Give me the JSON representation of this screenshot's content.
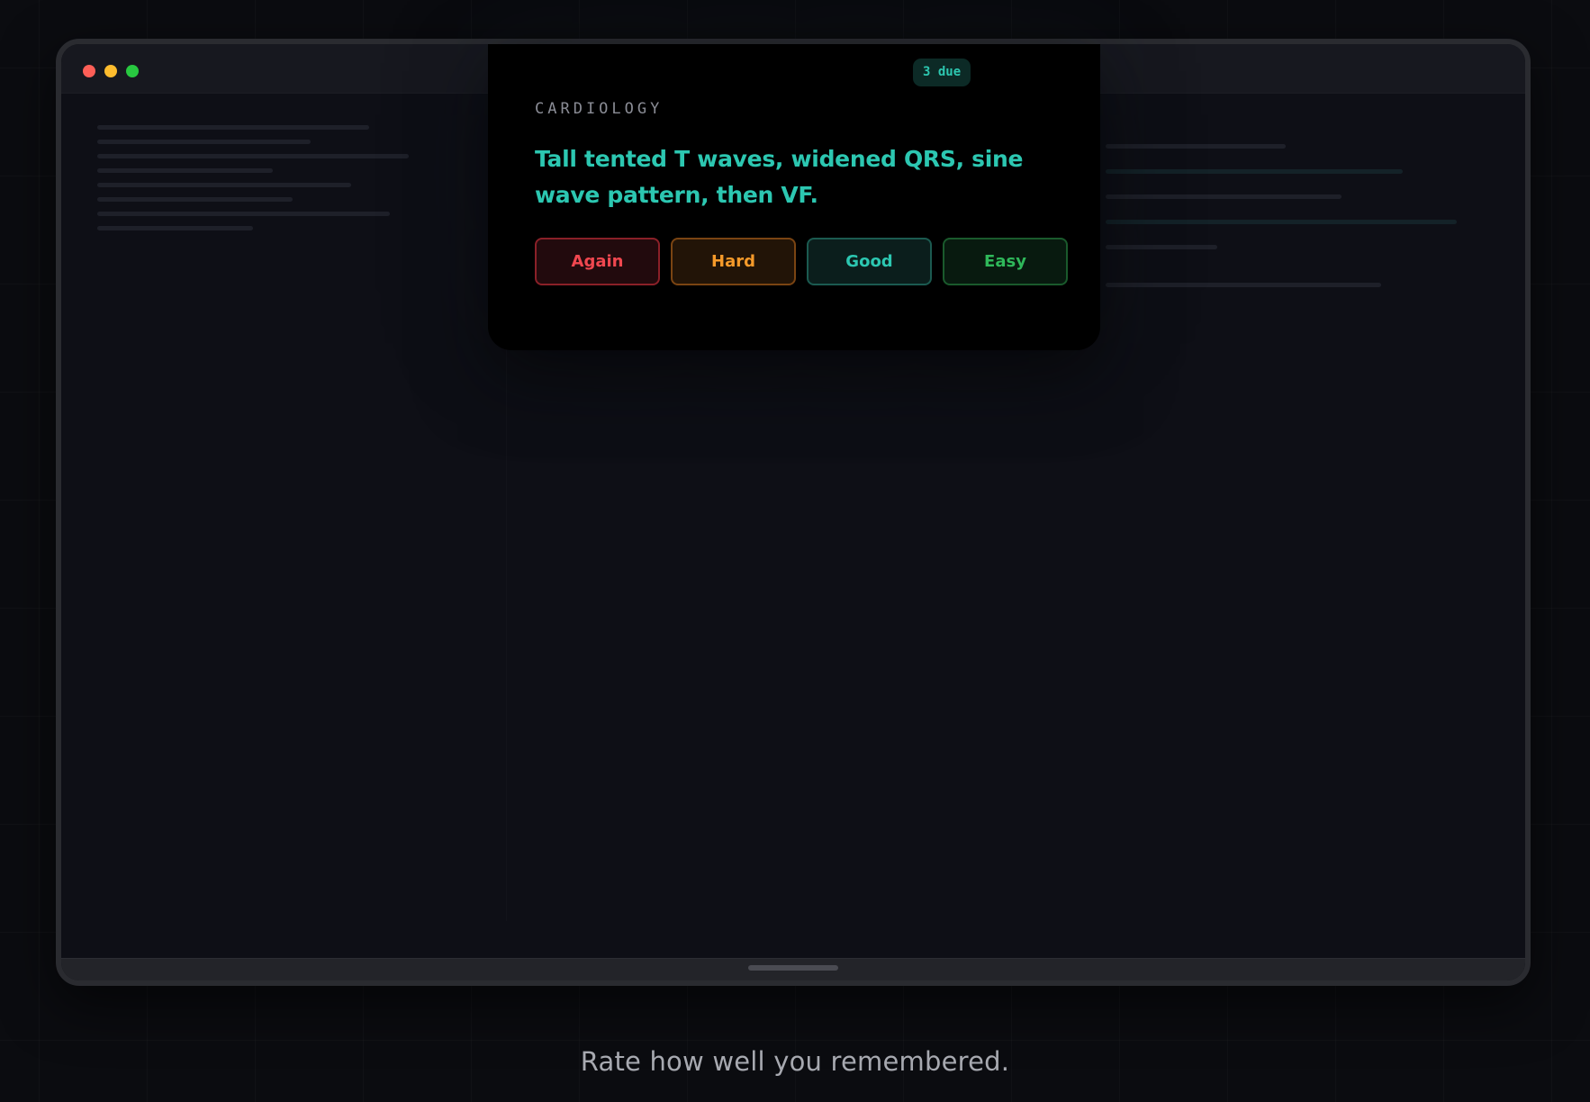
{
  "card": {
    "due_badge": "3 due",
    "category": "CARDIOLOGY",
    "text": "Tall tented T waves, widened QRS, sine wave pattern, then VF.",
    "buttons": {
      "again": "Again",
      "hard": "Hard",
      "good": "Good",
      "easy": "Easy"
    }
  },
  "caption": "Rate how well you remembered.",
  "colors": {
    "accent": "#2cc7b1",
    "again": "#f0474f",
    "hard": "#f59a2a",
    "good": "#2cc7b1",
    "easy": "#2fb85a"
  }
}
